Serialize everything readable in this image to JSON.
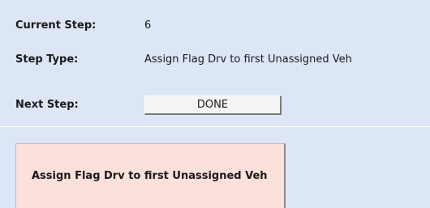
{
  "step_info": {
    "current_step_label": "Current Step:",
    "current_step_value": "6",
    "step_type_label": "Step Type:",
    "step_type_value": "Assign Flag Drv to first Unassigned Veh",
    "next_step_label": "Next Step:",
    "next_step_button": "DONE"
  },
  "step_card": {
    "label": "Assign Flag Drv to first Unassigned Veh"
  },
  "colors": {
    "panel_background": "#dce6f7",
    "card_background": "#fce0db",
    "button_background": "#f4f4f4"
  }
}
